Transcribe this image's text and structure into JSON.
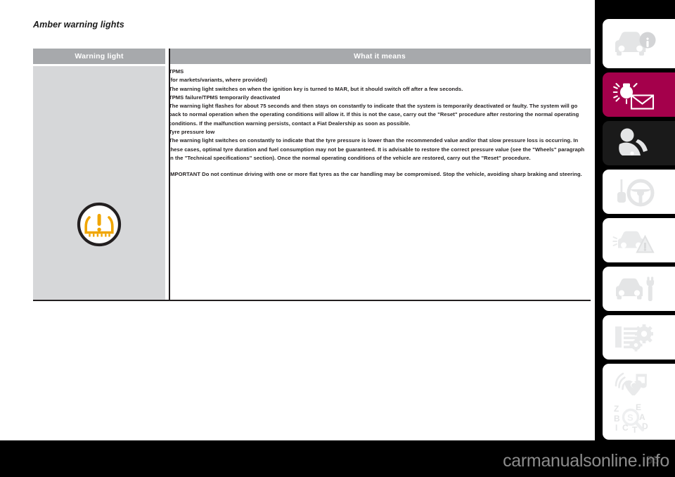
{
  "document": {
    "section_title": "Amber warning lights",
    "page_number": "55",
    "watermark": "carmanualsonline.info"
  },
  "table": {
    "headers": {
      "warning_light": "Warning light",
      "what_it_means": "What it means"
    },
    "warning_light_icon": "tpms-tyre-pressure-warning-icon",
    "content": {
      "heading_1": "TPMS",
      "subheading_1": "(for markets/variants, where provided)",
      "para_1": "The warning light switches on when the ignition key is turned to MAR, but it should switch off after a few seconds.",
      "heading_2": "TPMS failure/TPMS temporarily deactivated",
      "para_2": "The warning light flashes for about 75 seconds and then stays on constantly to indicate that the system is temporarily deactivated or faulty. The system will go back to normal operation when the operating conditions will allow it. If this is not the case, carry out the \"Reset\" procedure after restoring the normal operating conditions. If the malfunction warning persists, contact a Fiat Dealership as soon as possible.",
      "heading_3": "Tyre pressure low",
      "para_3": "The warning light switches on constantly to indicate that the tyre pressure is lower than the recommended value and/or that slow pressure loss is occurring. In these cases, optimal tyre duration and fuel consumption may not be guaranteed. It is advisable to restore the correct pressure value (see the \"Wheels\" paragraph in the \"Technical specifications\" section). Once the normal operating conditions of the vehicle are restored, carry out the \"Reset\" procedure.",
      "important_note": "IMPORTANT Do not continue driving with one or more flat tyres as the car handling may be compromised. Stop the vehicle, avoiding sharp braking and steering."
    }
  },
  "sidebar": {
    "tabs": [
      {
        "icon": "car-info-icon",
        "state": "inactive",
        "style": "white"
      },
      {
        "icon": "warning-light-mail-icon",
        "state": "active",
        "style": "red"
      },
      {
        "icon": "airbag-safety-icon",
        "state": "inactive",
        "style": "dark"
      },
      {
        "icon": "key-steering-wheel-icon",
        "state": "inactive",
        "style": "white"
      },
      {
        "icon": "car-breakdown-triangle-icon",
        "state": "inactive",
        "style": "white"
      },
      {
        "icon": "car-wrench-maintenance-icon",
        "state": "inactive",
        "style": "white"
      },
      {
        "icon": "specifications-gears-icon",
        "state": "inactive",
        "style": "white"
      },
      {
        "icon": "multimedia-audio-icon",
        "state": "inactive",
        "style": "white"
      },
      {
        "icon": "alphabetical-index-icon",
        "state": "inactive",
        "style": "white"
      }
    ]
  },
  "colors": {
    "accent_red": "#a4004b",
    "header_gray": "#a7a9ac",
    "cell_gray": "#d6d7d9",
    "amber": "#f0a500",
    "text": "#231f20"
  }
}
